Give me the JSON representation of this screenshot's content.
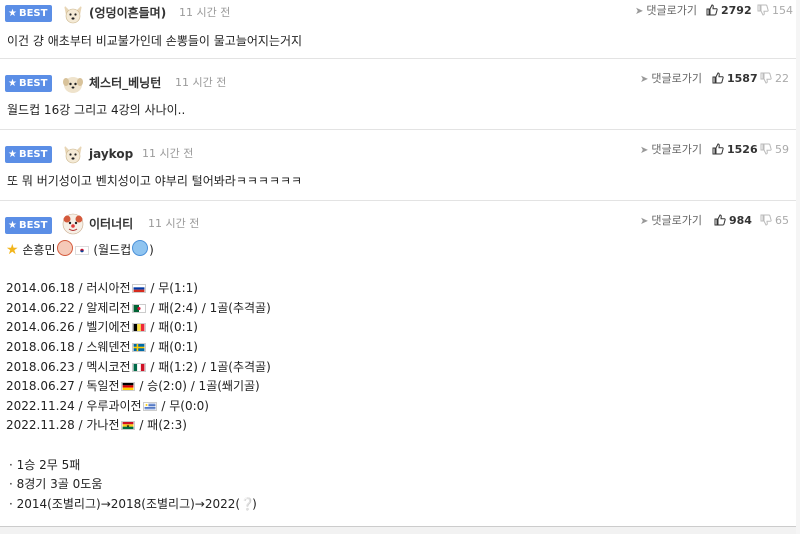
{
  "best_label": "BEST",
  "reply_label": "댓글로가기",
  "comments": [
    {
      "nick": "(엉덩이흔들며)",
      "time": "11 시간 전",
      "likes": "2792",
      "dislikes": "154",
      "avatar": "dog-face-avatar",
      "body": "이건 걍 애초부터 비교불가인데 손뽕들이 물고늘어지는거지"
    },
    {
      "nick": "체스터_베닝턴",
      "time": "11 시간 전",
      "likes": "1587",
      "dislikes": "22",
      "avatar": "small-dog-avatar",
      "body": "월드컵 16강 그리고 4강의 사나이.."
    },
    {
      "nick": "jaykop",
      "time": "11 시간 전",
      "likes": "1526",
      "dislikes": "59",
      "avatar": "dog-face-avatar",
      "body": "또 뭐 버기성이고 벤치성이고 야부리 털어봐라ㅋㅋㅋㅋㅋㅋ"
    },
    {
      "nick": "이터너티",
      "time": "11 시간 전",
      "likes": "984",
      "dislikes": "65",
      "avatar": "clown-avatar",
      "title_parts": [
        "손흥민",
        "(월드컵",
        ")"
      ],
      "matches": [
        {
          "pre": "2014.06.18 / 러시아전",
          "flag": "russia",
          "post": " / 무(1:1)"
        },
        {
          "pre": "2014.06.22 / 알제리전",
          "flag": "algeria",
          "post": " / 패(2:4) / 1골(추격골)"
        },
        {
          "pre": "2014.06.26 / 벨기에전",
          "flag": "belgium",
          "post": " / 패(0:1)"
        },
        {
          "pre": "2018.06.18 / 스웨덴전",
          "flag": "sweden",
          "post": " / 패(0:1)"
        },
        {
          "pre": "2018.06.23 / 멕시코전",
          "flag": "mexico",
          "post": " / 패(1:2) / 1골(추격골)"
        },
        {
          "pre": "2018.06.27 / 독일전",
          "flag": "germany",
          "post": " / 승(2:0) / 1골(쐐기골)"
        },
        {
          "pre": "2022.11.24 / 우루과이전",
          "flag": "uruguay",
          "post": " / 무(0:0)"
        },
        {
          "pre": "2022.11.28 / 가나전",
          "flag": "ghana",
          "post": " / 패(2:3)"
        }
      ],
      "summary": [
        "· 1승 2무 5패",
        "· 8경기 3골 0도움",
        "· 2014(조별리그)→2018(조별리그)→2022("
      ],
      "summary_end": ")"
    }
  ],
  "colors": {
    "best_badge": "#5b8ee6",
    "like_text": "#333333",
    "dislike_text": "#aaaaaa"
  }
}
